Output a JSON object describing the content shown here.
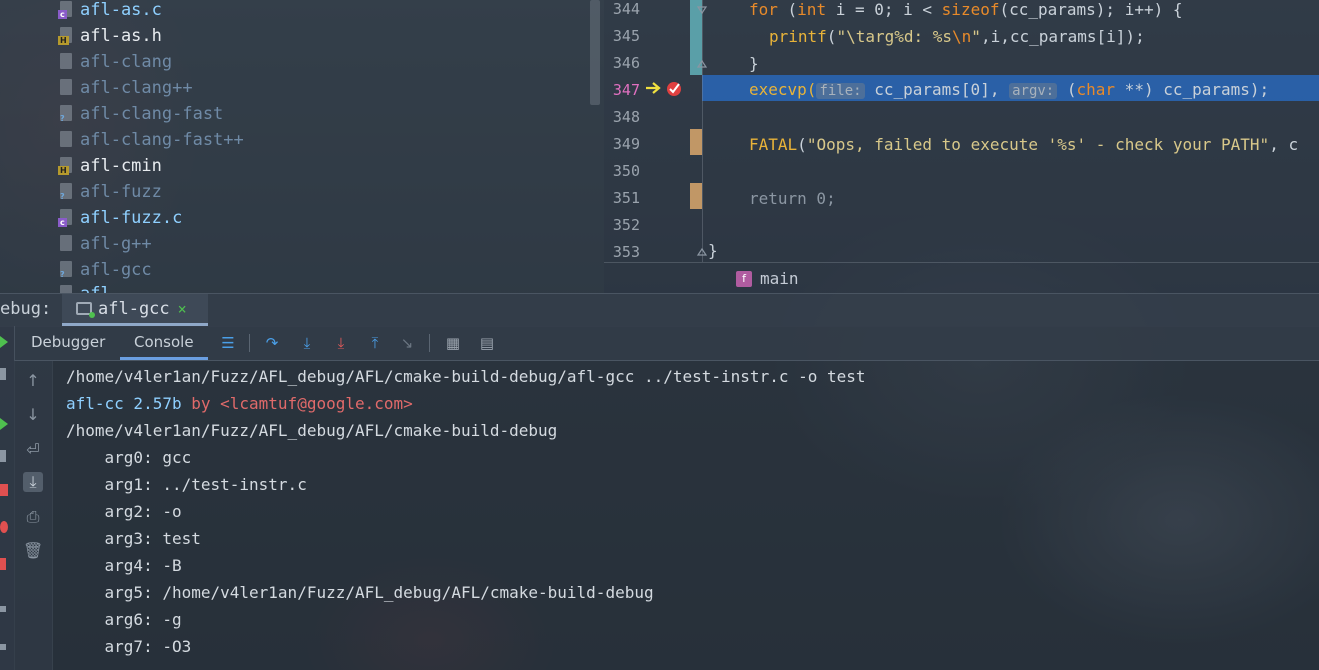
{
  "project_tree": {
    "files": [
      {
        "name": "afl-as.c",
        "type": "c"
      },
      {
        "name": "afl-as.h",
        "type": "h"
      },
      {
        "name": "afl-clang",
        "type": "bin"
      },
      {
        "name": "afl-clang++",
        "type": "bin"
      },
      {
        "name": "afl-clang-fast",
        "type": "unknown"
      },
      {
        "name": "afl-clang-fast++",
        "type": "bin"
      },
      {
        "name": "afl-cmin",
        "type": "h"
      },
      {
        "name": "afl-fuzz",
        "type": "unknown"
      },
      {
        "name": "afl-fuzz.c",
        "type": "c"
      },
      {
        "name": "afl-g++",
        "type": "bin"
      },
      {
        "name": "afl-gcc",
        "type": "unknown"
      },
      {
        "name": "afl",
        "type": "c"
      }
    ]
  },
  "editor": {
    "line_numbers": [
      "344",
      "345",
      "346",
      "347",
      "348",
      "349",
      "350",
      "351",
      "352",
      "353"
    ],
    "current_line": "347",
    "code": {
      "l344_for": "for",
      "l344_mid": " (",
      "l344_int": "int",
      "l344_rest": " i = 0; i < ",
      "l344_sizeof": "sizeof",
      "l344_tail": "(cc_params); i++) {",
      "l345_fn": "printf",
      "l345_open": "(",
      "l345_str1": "\"\\targ%d: %s",
      "l345_esc": "\\n",
      "l345_str2": "\"",
      "l345_tail": ",i,cc_params[i]);",
      "l346": "}",
      "l347_fn": "execvp(",
      "l347_hint1": "file:",
      "l347_arg1": " cc_params[0],",
      "l347_hint2": "argv:",
      "l347_arg2a": " (",
      "l347_char": "char",
      "l347_arg2b": " **) cc_params);",
      "l349_fn": "FATAL",
      "l349_open": "(",
      "l349_str": "\"Oops, failed to execute '%s' - check your PATH\"",
      "l349_tail": ", c",
      "l351": "return 0;",
      "l353": "}"
    },
    "breadcrumb": {
      "badge": "f",
      "label": "main"
    }
  },
  "debug_window": {
    "label": "ebug:",
    "session_tab": "afl-gcc",
    "close_symbol": "×",
    "tabs": {
      "debugger": "Debugger",
      "console": "Console"
    }
  },
  "console": {
    "command_line": "/home/v4ler1an/Fuzz/AFL_debug/AFL/cmake-build-debug/afl-gcc ../test-instr.c -o test",
    "banner_app": "afl-cc 2.57b",
    "banner_by": " by <lcamtuf@google.com>",
    "cwd": "/home/v4ler1an/Fuzz/AFL_debug/AFL/cmake-build-debug",
    "args": [
      "    arg0: gcc",
      "    arg1: ../test-instr.c",
      "    arg2: -o",
      "    arg3: test",
      "    arg4: -B",
      "    arg5: /home/v4ler1an/Fuzz/AFL_debug/AFL/cmake-build-debug",
      "    arg6: -g",
      "    arg7: -O3"
    ]
  },
  "colors": {
    "accent": "#8fd0ff",
    "highlight_line": "#2868c0",
    "breakpoint": "#e04040",
    "keyword": "#e88a2a",
    "function": "#e8b339"
  }
}
